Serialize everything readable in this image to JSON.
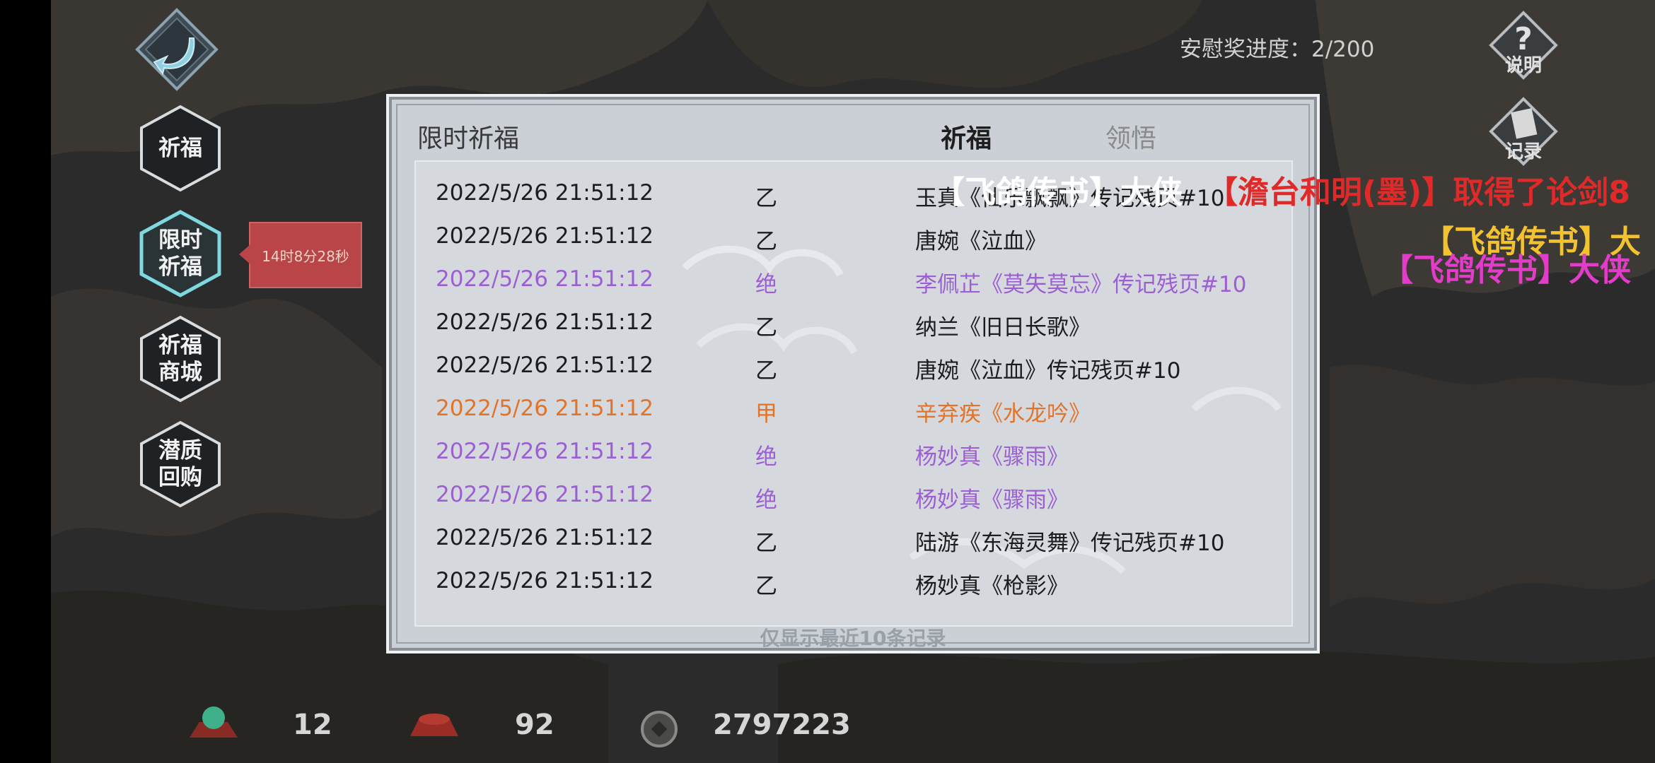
{
  "header": {
    "progress_text": "安慰奖进度：2/200",
    "help_label": "说明",
    "record_label": "记录"
  },
  "sidebar": {
    "items": [
      {
        "label": "祈福"
      },
      {
        "label": "限时\n祈福"
      },
      {
        "label": "祈福\n商城"
      },
      {
        "label": "潜质\n回购"
      }
    ],
    "timer": "14时8分28秒"
  },
  "panel": {
    "title": "限时祈福",
    "tabs": [
      {
        "label": "祈福",
        "active": true
      },
      {
        "label": "领悟",
        "active": false
      }
    ],
    "rows": [
      {
        "time": "2022/5/26 21:51:12",
        "grade": "乙",
        "item": "玉真《仙乐飘飘》传记残页#10",
        "color": "black"
      },
      {
        "time": "2022/5/26 21:51:12",
        "grade": "乙",
        "item": "唐婉《泣血》",
        "color": "black"
      },
      {
        "time": "2022/5/26 21:51:12",
        "grade": "绝",
        "item": "李佩芷《莫失莫忘》传记残页#10",
        "color": "purple"
      },
      {
        "time": "2022/5/26 21:51:12",
        "grade": "乙",
        "item": "纳兰《旧日长歌》",
        "color": "black"
      },
      {
        "time": "2022/5/26 21:51:12",
        "grade": "乙",
        "item": "唐婉《泣血》传记残页#10",
        "color": "black"
      },
      {
        "time": "2022/5/26 21:51:12",
        "grade": "甲",
        "item": "辛弃疾《水龙吟》",
        "color": "orange"
      },
      {
        "time": "2022/5/26 21:51:12",
        "grade": "绝",
        "item": "杨妙真《骤雨》",
        "color": "purple"
      },
      {
        "time": "2022/5/26 21:51:12",
        "grade": "绝",
        "item": "杨妙真《骤雨》",
        "color": "purple"
      },
      {
        "time": "2022/5/26 21:51:12",
        "grade": "乙",
        "item": "陆游《东海灵舞》传记残页#10",
        "color": "black"
      },
      {
        "time": "2022/5/26 21:51:12",
        "grade": "乙",
        "item": "杨妙真《枪影》",
        "color": "black"
      }
    ],
    "footer_note": "仅显示最近10条记录"
  },
  "danmu": [
    {
      "text": "【飞鸽传书】大侠",
      "color": "#ffffff"
    },
    {
      "text": "【澹台和明(墨)】取得了论剑8",
      "color": "#e02a2a"
    },
    {
      "text": "【飞鸽传书】大",
      "color": "#f2c230"
    },
    {
      "text": "【飞鸽传书】大侠",
      "color": "#e33cc8"
    }
  ],
  "resources": {
    "jade": "12",
    "token": "92",
    "coins": "2797223"
  },
  "colors": {
    "purple": "#9b5fd1",
    "orange": "#e0742a",
    "timer_bg": "#b94548"
  }
}
